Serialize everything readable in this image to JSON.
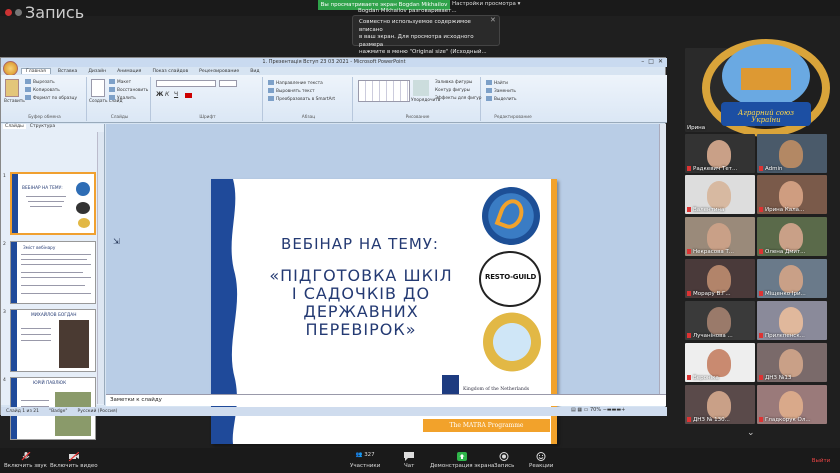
{
  "zoom": {
    "recording_label": "Запись",
    "share_banner": "Вы просматриваете экран Bogdan Mikhailov",
    "view_options": "Настройки просмотра",
    "speaker_label": "Bogdan Mikhailov разговаривает...",
    "tooltip": {
      "line1": "Совместно используемое содержимое вписано",
      "line2": "в ваш экран. Для просмотра исходного размера",
      "line3": "нажмите в меню \"Original size\" (Исходный..."
    },
    "toolbar": {
      "mute": "Включить звук",
      "video": "Включить видео",
      "participants": "Участники",
      "participants_count": "327",
      "chat": "Чат",
      "share": "Демонстрация экрана",
      "record": "Запись",
      "reactions": "Реакции",
      "leave": "Выйти"
    },
    "gallery": [
      {
        "name": "Ирина",
        "row": 0
      },
      {
        "name": "Радкевич Тет...",
        "row": 1
      },
      {
        "name": "Admin",
        "row": 1
      },
      {
        "name": "Валентина",
        "row": 2
      },
      {
        "name": "Ирина Кала...",
        "row": 2
      },
      {
        "name": "Некрасова Т...",
        "row": 3
      },
      {
        "name": "Олена Дмит...",
        "row": 3
      },
      {
        "name": "Морару В.Г...",
        "row": 4
      },
      {
        "name": "Міщенко Іри...",
        "row": 4
      },
      {
        "name": "Лучанінова ...",
        "row": 5
      },
      {
        "name": "Прилєпенск...",
        "row": 5
      },
      {
        "name": "Вероніка",
        "row": 6
      },
      {
        "name": "ДНЗ №13",
        "row": 6
      },
      {
        "name": "ДНЗ № 130...",
        "row": 7
      },
      {
        "name": "Гладкорук Ол...",
        "row": 7
      }
    ],
    "logo_ribbon": "Аграрний союз України"
  },
  "ppt": {
    "window_title": "1. Презентація Вступ 23 03 2021 - Microsoft PowerPoint",
    "tabs": [
      "Главная",
      "Вставка",
      "Дизайн",
      "Анимация",
      "Показ слайдов",
      "Рецензирование",
      "Вид"
    ],
    "ribbon_groups": [
      "Буфер обмена",
      "Слайды",
      "Шрифт",
      "Абзац",
      "Рисование",
      "Редактирование"
    ],
    "ribbon": {
      "paste": "Вставить",
      "cut": "Вырезать",
      "copy": "Копировать",
      "format": "Формат по образцу",
      "create_slide": "Создать слайд",
      "layout": "Макет",
      "restore": "Восстановить",
      "delete": "Удалить",
      "arrange": "Упорядочить",
      "express": "Экспресс-стили",
      "find": "Найти",
      "replace": "Заменить",
      "select": "Выделить",
      "fill": "Заливка фигуры",
      "outline": "Контур фигуры",
      "effects": "Эффекты для фигур",
      "text_dir": "Направление текста",
      "align_text": "Выровнять текст",
      "smartart": "Преобразовать в SmartArt"
    },
    "panel_tabs": [
      "Слайды",
      "Структура"
    ],
    "thumbnails": [
      {
        "num": "1",
        "title": "ВЕБІНАР НА ТЕМУ:"
      },
      {
        "num": "2",
        "title": "Зміст вебінару"
      },
      {
        "num": "3",
        "title": "МИХАЙЛОВ БОГДАН"
      },
      {
        "num": "4",
        "title": "ЮРІЙ ПАВЛЮК"
      },
      {
        "num": "5",
        "title": "ЗОРІНА ГРОЗДЗА"
      }
    ],
    "slide": {
      "title1": "ВЕБІНАР НА ТЕМУ:",
      "title2_l1": "«ПІДГОТОВКА ШКІЛ",
      "title2_l2": "І САДОЧКІВ ДО",
      "title2_l3": "ДЕРЖАВНИХ",
      "title2_l4": "ПЕРЕВІРОК»",
      "resto_guild": "RESTO-GUILD",
      "netherlands": "Kingdom of the Netherlands",
      "matra": "The MATRA Programme"
    },
    "notes_placeholder": "Заметки к слайду",
    "status": {
      "slide": "Слайд 1 из 21",
      "theme": "\"Badge\"",
      "lang": "Русский (Россия)",
      "zoom": "70%"
    },
    "accent": "#243a73",
    "orange": "#f2a22b",
    "blue_band": "#1f4a9a"
  }
}
